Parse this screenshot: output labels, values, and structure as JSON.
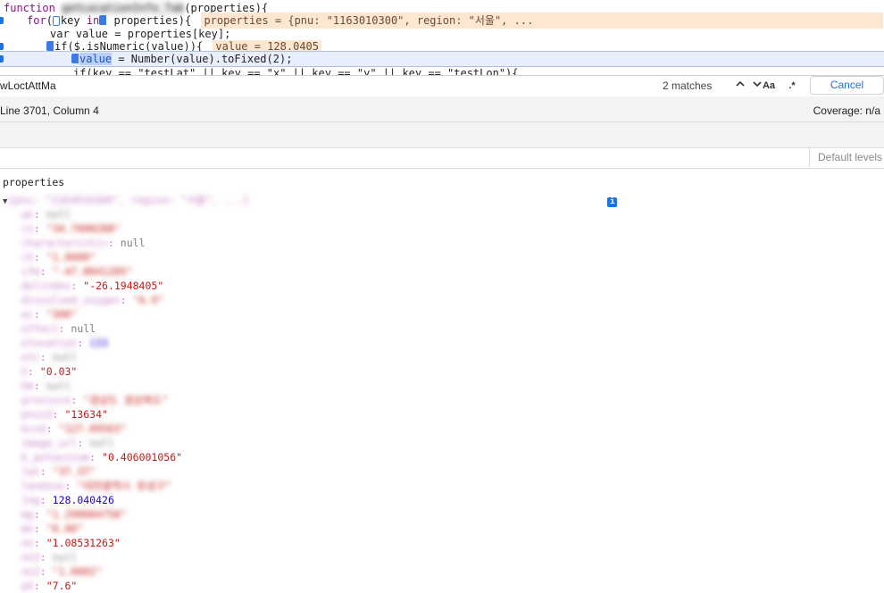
{
  "code": {
    "line1": {
      "kw": "function",
      "name": "getLocationInfo_Tab",
      "sig": "(properties){"
    },
    "line2": {
      "kw1": "for",
      "rest": "key ",
      "kw2": "in",
      "rest2": " properties){",
      "inline": "properties = {pnu: \"1163010300\", region: \"서울\", ..."
    },
    "line3": {
      "text": "var value = properties[key];"
    },
    "line4": {
      "text": "if($.isNumeric(value)){",
      "inline": "value = 128.0405"
    },
    "line5": {
      "sel": "value",
      "rest": " = Number(value).toFixed(2);"
    },
    "line6": {
      "text": "if(key == \"testLat\" || key == \"x\" || key == \"y\" || key == \"testLon\"){"
    }
  },
  "search": {
    "query": "wLoctAttMa",
    "matches": "2 matches",
    "up_icon": "chevron-up-icon",
    "down_icon": "chevron-down-icon",
    "match_case": "Aa",
    "regex": ".*",
    "cancel": "Cancel"
  },
  "status": {
    "position": "Line 3701, Column 4",
    "coverage": "Coverage: n/a"
  },
  "filter": {
    "levels": "Default levels"
  },
  "console": {
    "label": "properties",
    "summary": "{pnu: \"1163010300\", region: \"서울\", ...}",
    "info_icon": "info-icon",
    "rows": [
      {
        "k": "an",
        "v": "null",
        "t": "null"
      },
      {
        "k": "cn",
        "v": "\"34.7008288\"",
        "t": "str"
      },
      {
        "k": "characteristic",
        "v": "null",
        "t": "null"
      },
      {
        "k": "ch",
        "v": "\"1.0000\"",
        "t": "str"
      },
      {
        "k": "cfm",
        "v": "\"-47.8041285\"",
        "t": "str"
      },
      {
        "k": "dolindex",
        "v": "\"-26.1948405\"",
        "t": "str"
      },
      {
        "k": "dissolved_oxygen",
        "v": "\"6.9\"",
        "t": "str"
      },
      {
        "k": "ec",
        "v": "\"300\"",
        "t": "str"
      },
      {
        "k": "effect",
        "v": "null",
        "t": "null"
      },
      {
        "k": "elevation",
        "v": "133",
        "t": "num"
      },
      {
        "k": "etc",
        "v": "null",
        "t": "null"
      },
      {
        "k": "h",
        "v": "\"0.03\"",
        "t": "str"
      },
      {
        "k": "hm",
        "v": "null",
        "t": "null"
      },
      {
        "k": "province",
        "v": "\"경상도 경상북도\"",
        "t": "str"
      },
      {
        "k": "pnuid",
        "v": "\"13634\"",
        "t": "str"
      },
      {
        "k": "kcvd",
        "v": "\"127.09563\"",
        "t": "str"
      },
      {
        "k": "image_url",
        "v": "null",
        "t": "null"
      },
      {
        "k": "k_potassium",
        "v": "\"0.406001056\"",
        "t": "str"
      },
      {
        "k": "lat",
        "v": "\"37.37\"",
        "t": "str"
      },
      {
        "k": "landuse",
        "v": "\"대전광역시 유성구\"",
        "t": "str"
      },
      {
        "k": "lng",
        "v": "128.040426",
        "t": "num"
      },
      {
        "k": "mg",
        "v": "\"1.290004758\"",
        "t": "str"
      },
      {
        "k": "mn",
        "v": "\"0.00\"",
        "t": "str"
      },
      {
        "k": "nn",
        "v": "\"1.08531263\"",
        "t": "str"
      },
      {
        "k": "no3",
        "v": "null",
        "t": "null"
      },
      {
        "k": "no2",
        "v": "\"1.0002\"",
        "t": "str"
      },
      {
        "k": "ph",
        "v": "\"7.6\"",
        "t": "str"
      }
    ]
  }
}
